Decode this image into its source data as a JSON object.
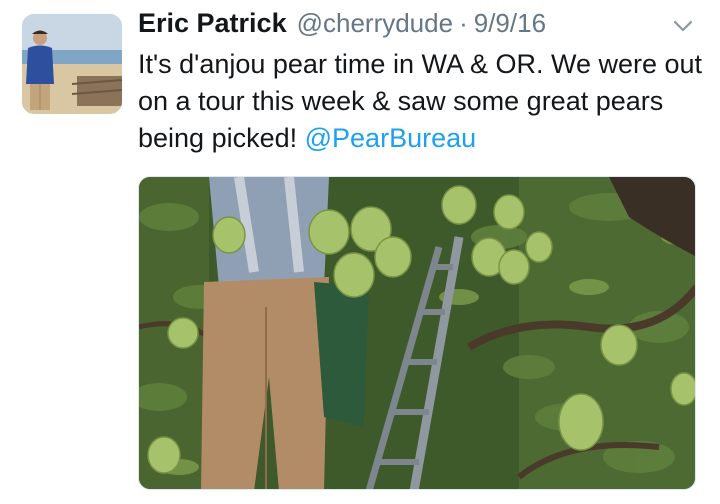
{
  "tweet": {
    "author_name": "Eric Patrick",
    "handle": "@cherrydude",
    "separator": "·",
    "date": "9/9/16",
    "text": "It's d'anjou pear time in WA & OR. We were out on a tour this week & saw some great pears being picked! ",
    "mention": "@PearBureau"
  },
  "icons": {
    "menu": "chevron-down-icon"
  },
  "colors": {
    "text": "#14171a",
    "secondary": "#657786",
    "link": "#1da1f2"
  }
}
